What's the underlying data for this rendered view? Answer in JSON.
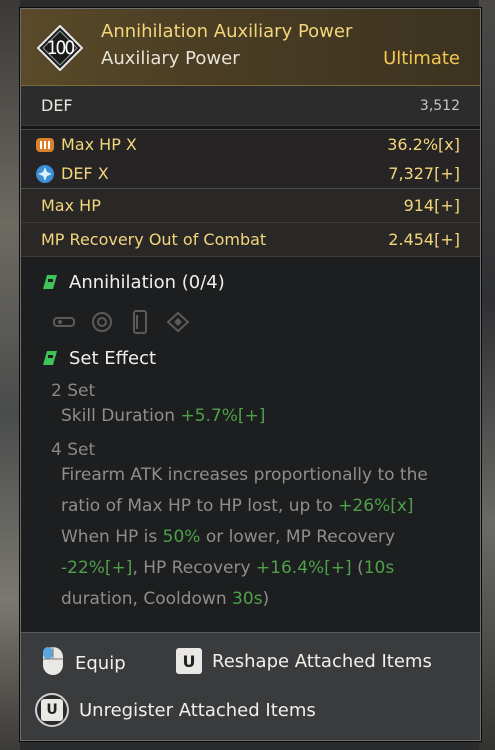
{
  "item": {
    "level": "100",
    "name": "Annihilation Auxiliary Power",
    "type": "Auxiliary Power",
    "rarity": "Ultimate"
  },
  "base_stat": {
    "label": "DEF",
    "value": "3,512"
  },
  "sub_stats": [
    {
      "label": "Max HP X",
      "value": "36.2%[x]",
      "icon": "max-hp-icon"
    },
    {
      "label": "DEF X",
      "value": "7,327[+]",
      "icon": "def-icon"
    }
  ],
  "extra_stats": [
    {
      "label": "Max HP",
      "value": "914[+]"
    },
    {
      "label": "MP Recovery Out of Combat",
      "value": "2.454[+]"
    }
  ],
  "set": {
    "title": "Annihilation (0/4)",
    "slots": [
      "weapon-part-icon",
      "gear-part-icon",
      "body-part-icon",
      "diamond-part-icon"
    ],
    "effect_title": "Set Effect",
    "two_set_label": "2 Set",
    "two_set_text": "Skill Duration",
    "two_set_value": "+5.7%[+]",
    "four_set_label": "4 Set",
    "four_set_line1": "Firearm ATK increases proportionally to the",
    "four_set_line2a": "ratio of Max HP to HP lost, up to ",
    "four_set_line2b": "+26%[x]",
    "four_set_line3a": "When HP is ",
    "four_set_line3b": "50%",
    "four_set_line3c": " or lower, MP Recovery",
    "four_set_line4a": "-22%[+]",
    "four_set_line4b": ", HP Recovery ",
    "four_set_line4c": "+16.4%[+]",
    "four_set_line4d": " (",
    "four_set_line4e": "10s",
    "four_set_line5a": "duration, Cooldown ",
    "four_set_line5b": "30s",
    "four_set_line5c": ")"
  },
  "actions": {
    "equip": "Equip",
    "reshape_key": "U",
    "reshape": "Reshape Attached Items",
    "unregister_key": "U",
    "unregister": "Unregister Attached Items"
  },
  "colors": {
    "name": "#f3d67b",
    "rarity": "#f4c850",
    "highlight": "#4ea14a",
    "desc": "#8f8e89"
  }
}
